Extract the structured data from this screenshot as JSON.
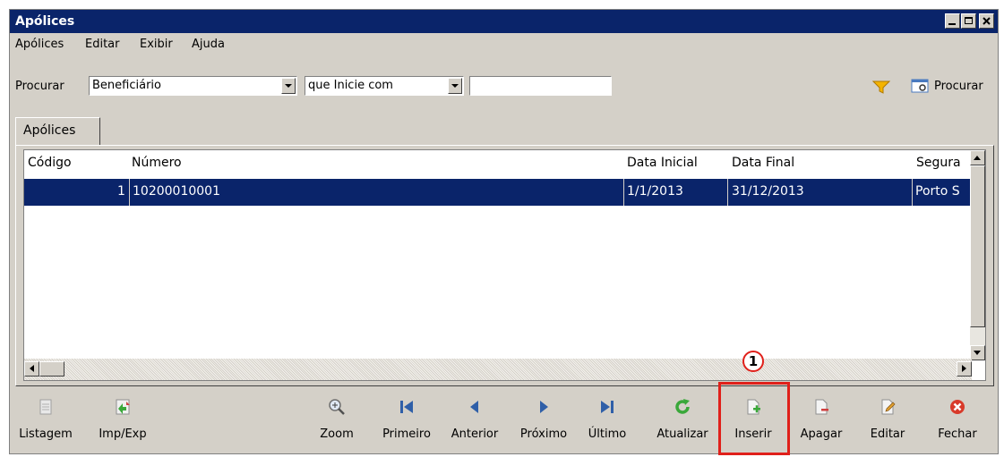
{
  "window": {
    "title": "Apólices"
  },
  "menu": [
    {
      "label": "Apólices"
    },
    {
      "label": "Editar"
    },
    {
      "label": "Exibir"
    },
    {
      "label": "Ajuda"
    }
  ],
  "search": {
    "label": "Procurar",
    "field_value": "Beneficiário",
    "condition_value": "que Inicie com",
    "text_value": "",
    "button_label": "Procurar"
  },
  "tab": {
    "label": "Apólices"
  },
  "grid": {
    "columns": [
      "Código",
      "Número",
      "Data Inicial",
      "Data Final",
      "Segura"
    ],
    "rows": [
      {
        "codigo": "1",
        "numero": "10200010001",
        "data_inicial": "1/1/2013",
        "data_final": "31/12/2013",
        "seguradora": "Porto S"
      }
    ]
  },
  "toolbar": [
    {
      "label": "Listagem",
      "icon": "list-icon"
    },
    {
      "label": "Imp/Exp",
      "icon": "import-export-icon"
    },
    {
      "label": "Zoom",
      "icon": "zoom-icon"
    },
    {
      "label": "Primeiro",
      "icon": "first-icon"
    },
    {
      "label": "Anterior",
      "icon": "previous-icon"
    },
    {
      "label": "Próximo",
      "icon": "next-icon"
    },
    {
      "label": "Último",
      "icon": "last-icon"
    },
    {
      "label": "Atualizar",
      "icon": "refresh-icon"
    },
    {
      "label": "Inserir",
      "icon": "insert-icon"
    },
    {
      "label": "Apagar",
      "icon": "delete-icon"
    },
    {
      "label": "Editar",
      "icon": "edit-icon"
    },
    {
      "label": "Fechar",
      "icon": "close-icon"
    }
  ],
  "annotation": {
    "marker": "1",
    "color": "#e0201a"
  },
  "colors": {
    "title_bar": "#0a246a",
    "selection": "#0a246a",
    "face": "#d4d0c8"
  }
}
